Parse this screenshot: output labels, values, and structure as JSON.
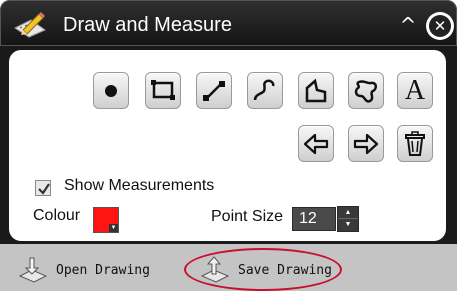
{
  "window": {
    "title": "Draw and Measure",
    "title_icon": "pencil-ruler-icon",
    "collapse_icon": "chevron-up-icon",
    "close_icon": "close-icon"
  },
  "tools": {
    "row1": [
      "point-tool-icon",
      "rectangle-tool-icon",
      "line-tool-icon",
      "freehand-line-tool-icon",
      "polygon-tool-icon",
      "freehand-polygon-tool-icon",
      "text-tool-icon"
    ],
    "row2": [
      "undo-icon",
      "redo-icon",
      "trash-icon"
    ],
    "text_tool_glyph": "A"
  },
  "options": {
    "show_measurements_label": "Show Measurements",
    "show_measurements_checked": true,
    "colour_label": "Colour",
    "colour_value": "#ff1414",
    "point_size_label": "Point Size",
    "point_size_value": "12"
  },
  "footer": {
    "open_label": "Open Drawing",
    "save_label": "Save Drawing"
  },
  "colors": {
    "titlebar": "#1a1a1a",
    "footer": "#c4c4c4",
    "highlight": "#c8102e"
  }
}
